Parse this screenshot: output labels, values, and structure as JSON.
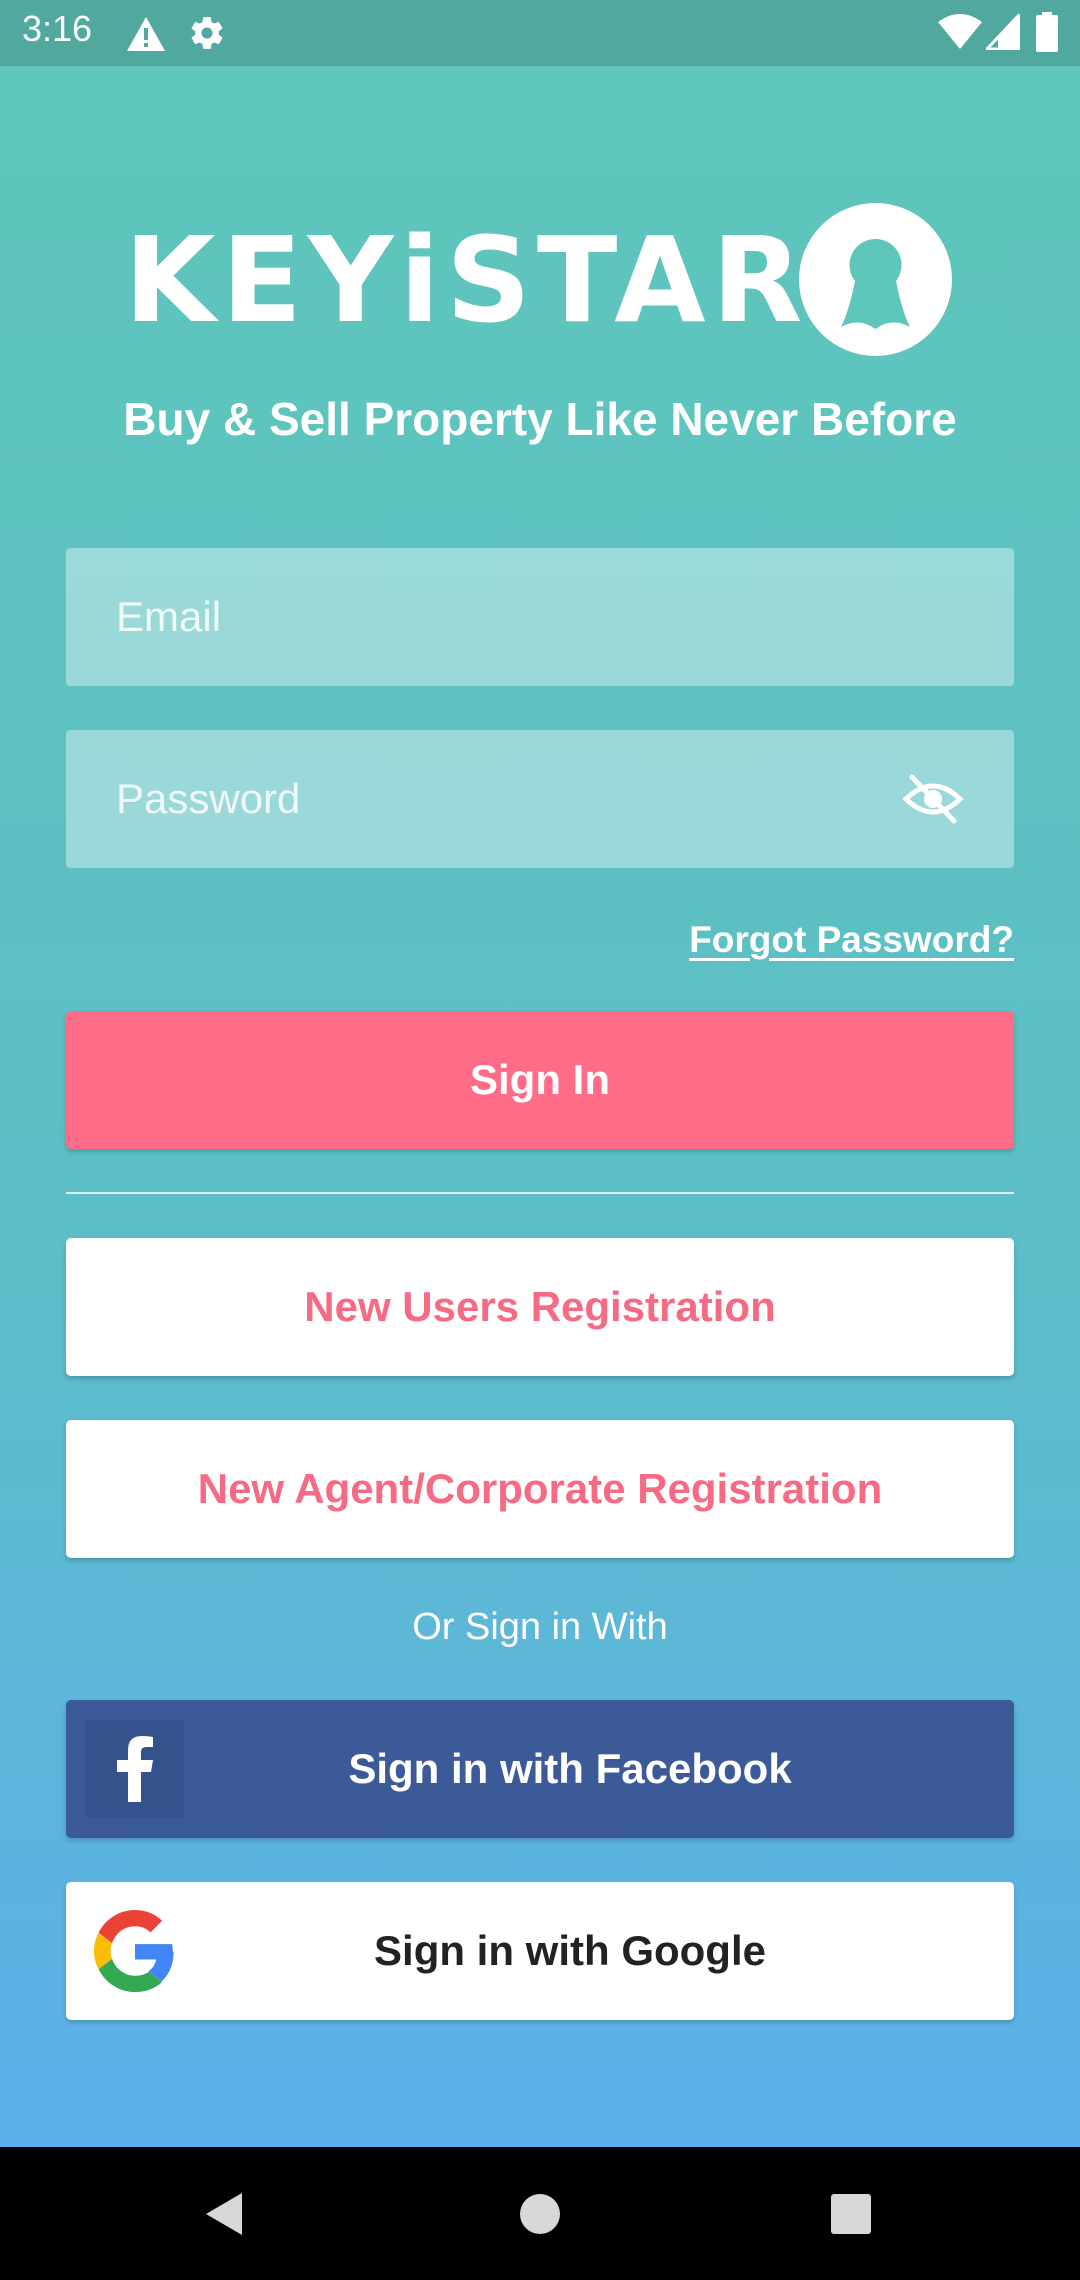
{
  "status_bar": {
    "time": "3:16",
    "icons": [
      "warning-icon",
      "settings-icon",
      "wifi-icon",
      "signal-icon",
      "battery-icon"
    ]
  },
  "brand": {
    "logo_text": "KEYiSTAR",
    "tagline": "Buy & Sell Property Like Never Before"
  },
  "form": {
    "email_placeholder": "Email",
    "email_value": "",
    "password_placeholder": "Password",
    "password_value": "",
    "forgot_password": "Forgot Password?"
  },
  "buttons": {
    "sign_in": "Sign In",
    "new_users_registration": "New Users Registration",
    "new_agent_registration": "New Agent/Corporate Registration",
    "or_sign_in_with": "Or Sign in With",
    "facebook": "Sign in with Facebook",
    "google": "Sign in with Google"
  },
  "colors": {
    "accent_pink": "#fe6c87",
    "teal": "#5ec6bb",
    "facebook_blue": "#3c5998"
  },
  "nav_bar": {
    "icons": [
      "back-icon",
      "home-icon",
      "recents-icon"
    ]
  }
}
